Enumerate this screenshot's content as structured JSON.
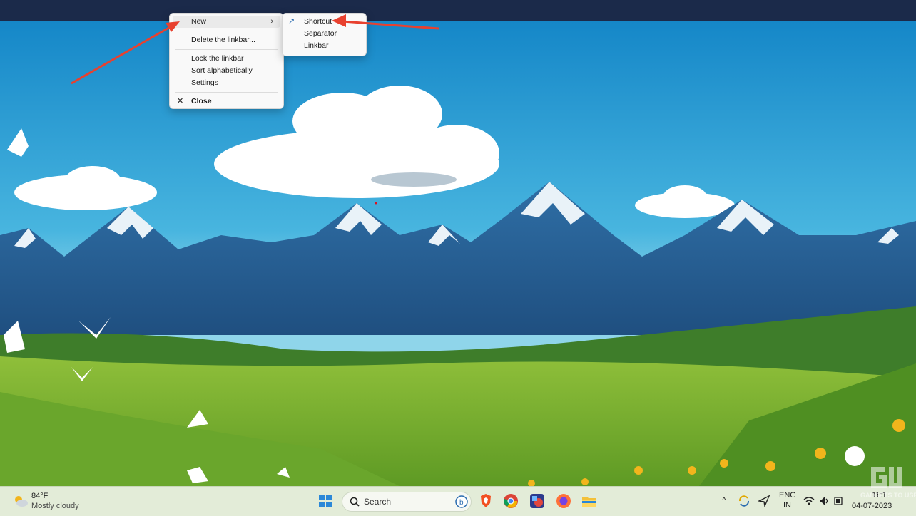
{
  "context_menu": {
    "items": [
      {
        "label": "New",
        "has_submenu": true
      },
      {
        "label": "Delete the linkbar..."
      },
      {
        "label": "Lock the linkbar"
      },
      {
        "label": "Sort alphabetically"
      },
      {
        "label": "Settings"
      },
      {
        "label": "Close"
      }
    ]
  },
  "submenu": {
    "items": [
      {
        "label": "Shortcut",
        "icon": "shortcut-arrow-icon"
      },
      {
        "label": "Separator"
      },
      {
        "label": "Linkbar"
      }
    ]
  },
  "taskbar": {
    "weather": {
      "temp": "84°F",
      "condition": "Mostly cloudy",
      "icon": "partly-cloudy-icon"
    },
    "search_placeholder": "Search",
    "pinned_apps": [
      "windows-start-icon",
      "bing-icon",
      "brave-icon",
      "chrome-icon",
      "photo-editor-icon",
      "firefox-icon",
      "file-explorer-icon"
    ],
    "language": {
      "line1": "ENG",
      "line2": "IN"
    },
    "clock": {
      "time": "11:1",
      "date": "04-07-2023"
    }
  },
  "watermark": {
    "text": "GADGETS TO USE"
  },
  "colors": {
    "accent_arrow": "#e8412f",
    "topbar": "#1b2a4a",
    "taskbar": "#e3ecd8"
  }
}
